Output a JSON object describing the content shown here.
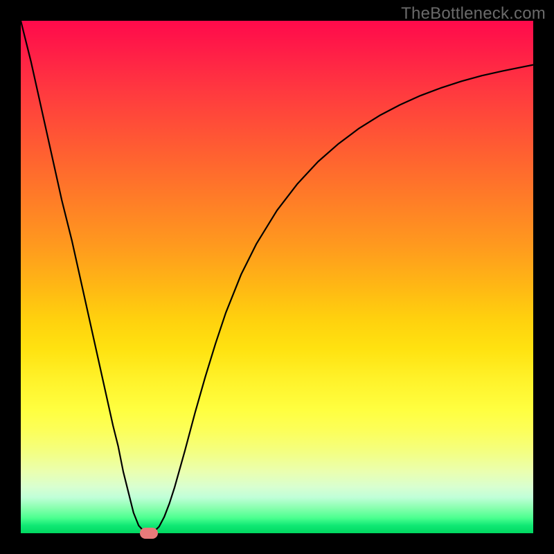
{
  "attribution": "TheBottleneck.com",
  "chart_data": {
    "type": "line",
    "title": "",
    "xlabel": "",
    "ylabel": "",
    "xlim": [
      0,
      100
    ],
    "ylim": [
      0,
      100
    ],
    "background_gradient": {
      "top": "#ff0a4b",
      "mid": "#ffd000",
      "bottom": "#00d860"
    },
    "series": [
      {
        "name": "curve",
        "x": [
          0,
          2,
          4,
          6,
          8,
          10,
          12,
          14,
          16,
          18,
          19,
          20,
          21,
          22,
          23,
          24,
          25,
          26,
          27,
          28,
          29,
          30,
          32,
          34,
          36,
          38,
          40,
          43,
          46,
          50,
          54,
          58,
          62,
          66,
          70,
          74,
          78,
          82,
          86,
          90,
          94,
          98,
          100
        ],
        "y": [
          100,
          92,
          83,
          74,
          65,
          57,
          48,
          39,
          30,
          21,
          17,
          12,
          8,
          4,
          1.5,
          0.4,
          0,
          0.3,
          1.3,
          3.2,
          5.8,
          8.9,
          16,
          23.5,
          30.5,
          37,
          43,
          50.5,
          56.5,
          63,
          68.2,
          72.5,
          76,
          79,
          81.5,
          83.6,
          85.4,
          86.9,
          88.2,
          89.3,
          90.2,
          91,
          91.4
        ]
      }
    ],
    "marker": {
      "x": 25,
      "y": 0,
      "color": "#e87a7a"
    }
  }
}
